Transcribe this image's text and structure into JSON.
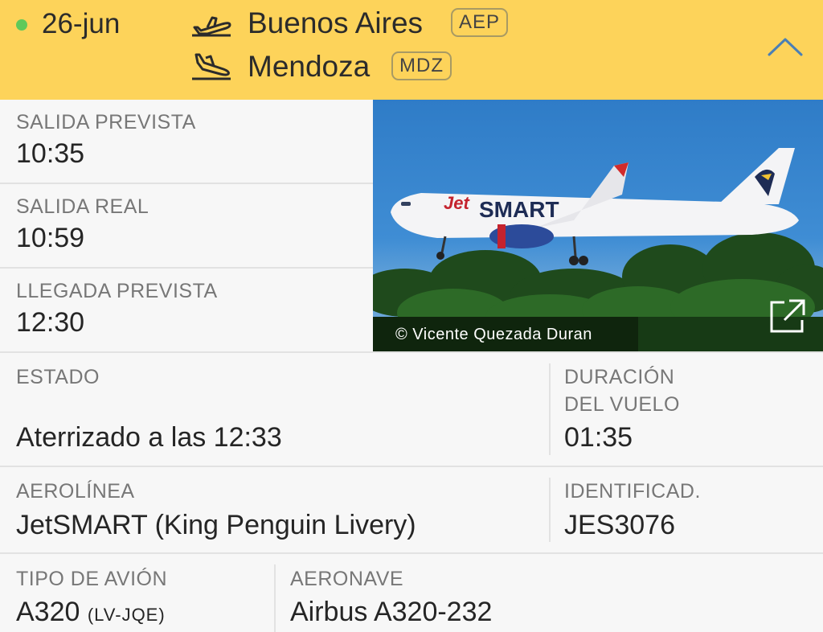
{
  "header": {
    "date": "26-jun",
    "origin": {
      "city": "Buenos Aires",
      "code": "AEP"
    },
    "destination": {
      "city": "Mendoza",
      "code": "MDZ"
    }
  },
  "times": {
    "scheduled_departure_label": "SALIDA PREVISTA",
    "scheduled_departure": "10:35",
    "actual_departure_label": "SALIDA REAL",
    "actual_departure": "10:59",
    "scheduled_arrival_label": "LLEGADA PREVISTA",
    "scheduled_arrival": "12:30"
  },
  "photo": {
    "credit": "© Vicente Quezada Duran"
  },
  "status": {
    "label": "ESTADO",
    "value": "Aterrizado a las 12:33",
    "duration_label_1": "DURACIÓN",
    "duration_label_2": "DEL VUELO",
    "duration": "01:35"
  },
  "airline": {
    "label": "AEROLÍNEA",
    "value": "JetSMART (King Penguin Livery)",
    "id_label": "IDENTIFICAD.",
    "id_value": "JES3076"
  },
  "aircraft": {
    "type_label": "TIPO DE AVIÓN",
    "type_value": "A320",
    "registration": "(LV-JQE)",
    "model_label": "AERONAVE",
    "model_value": "Airbus A320-232"
  }
}
